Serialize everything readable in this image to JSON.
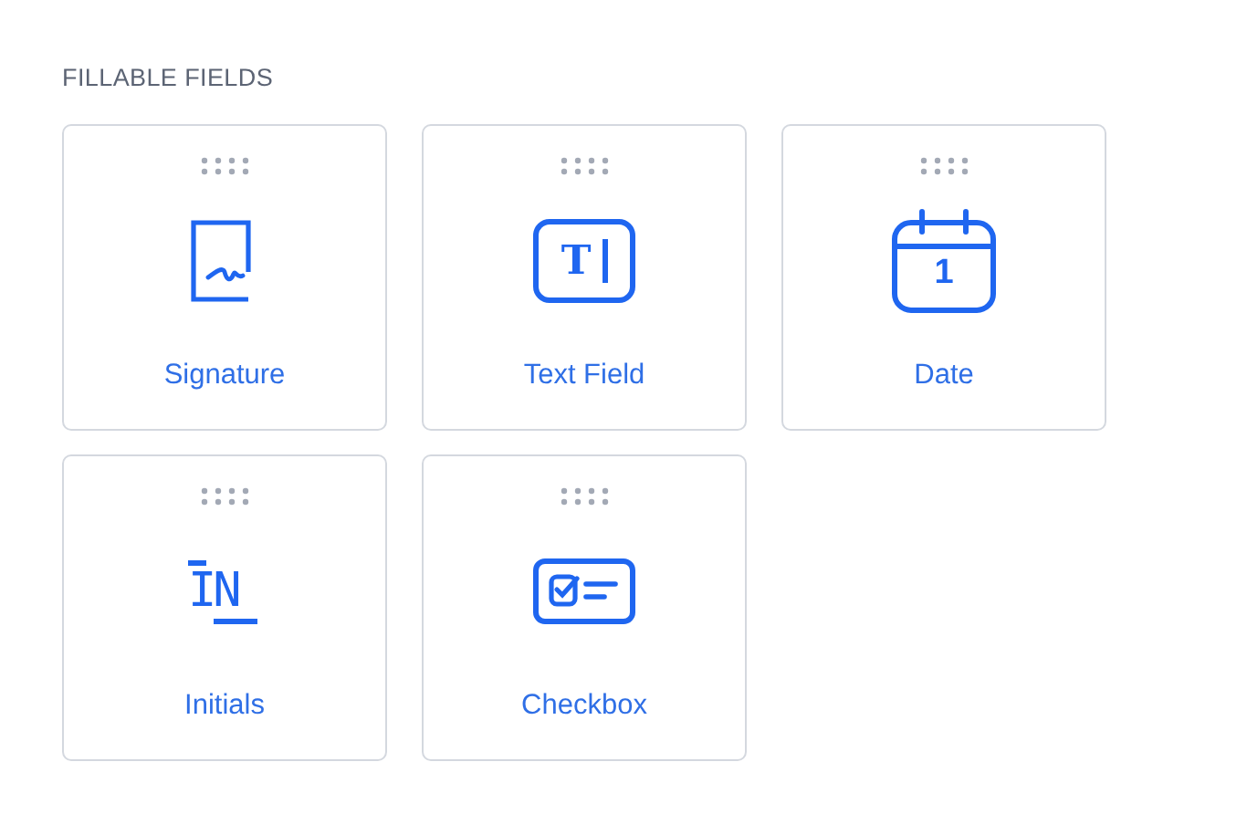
{
  "section": {
    "title": "FILLABLE FIELDS"
  },
  "fields": [
    {
      "kind": "signature",
      "label": "Signature"
    },
    {
      "kind": "text",
      "label": "Text Field",
      "glyph": "T"
    },
    {
      "kind": "date",
      "label": "Date",
      "glyph": "1"
    },
    {
      "kind": "initials",
      "label": "Initials",
      "glyph": "IN"
    },
    {
      "kind": "checkbox",
      "label": "Checkbox"
    }
  ]
}
